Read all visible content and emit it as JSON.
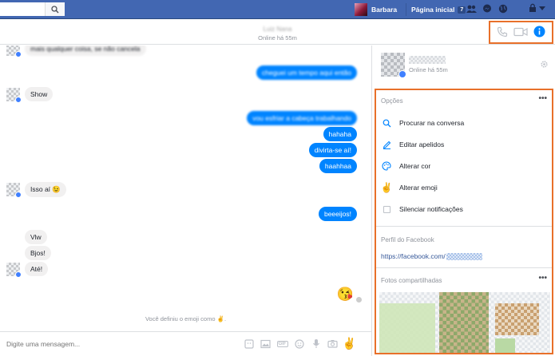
{
  "topbar": {
    "search_placeholder": "",
    "user_name": "Barbara",
    "home_label": "Página inicial",
    "home_badge": "7"
  },
  "conversation": {
    "contact_name": "Luiz Nana",
    "status": "Online há 55m"
  },
  "messages": [
    {
      "dir": "in",
      "text": "mais qualquer coisa, se não cancela",
      "blurred": true
    },
    {
      "dir": "out",
      "text": "cheguei um tempo aqui então",
      "blurred": true
    },
    {
      "dir": "in",
      "text": "Show"
    },
    {
      "dir": "out",
      "text": "vou esfriar a cabeça trabalhando",
      "blurred": true
    },
    {
      "dir": "out",
      "text": "hahaha"
    },
    {
      "dir": "out",
      "text": "divirta-se aí!"
    },
    {
      "dir": "out",
      "text": "haahhaa"
    },
    {
      "dir": "in",
      "text": "Isso aí 😉"
    },
    {
      "dir": "out",
      "text": "beeeijos!"
    },
    {
      "dir": "in",
      "text": "Vlw"
    },
    {
      "dir": "in",
      "text": "Bjos!"
    },
    {
      "dir": "in",
      "text": "Até!"
    },
    {
      "dir": "out",
      "text": "😘"
    }
  ],
  "system_note": "Você definiu o emoji como ✌️.",
  "composer": {
    "placeholder": "Digite uma mensagem..."
  },
  "info_panel": {
    "status": "Online há 55m",
    "options_title": "Opções",
    "options": [
      {
        "label": "Procurar na conversa",
        "icon": "search-icon"
      },
      {
        "label": "Editar apelidos",
        "icon": "pencil-icon"
      },
      {
        "label": "Alterar cor",
        "icon": "palette-icon"
      },
      {
        "label": "Alterar emoji",
        "icon": "victory-hand-icon"
      },
      {
        "label": "Silenciar notificações",
        "icon": "checkbox-icon"
      }
    ],
    "profile_title": "Perfil do Facebook",
    "profile_link": "https://facebook.com/",
    "photos_title": "Fotos compartilhadas",
    "more": "•••"
  },
  "colors": {
    "facebook_blue": "#4267b2",
    "messenger_blue": "#0084ff",
    "highlight_orange": "#e8702a"
  }
}
